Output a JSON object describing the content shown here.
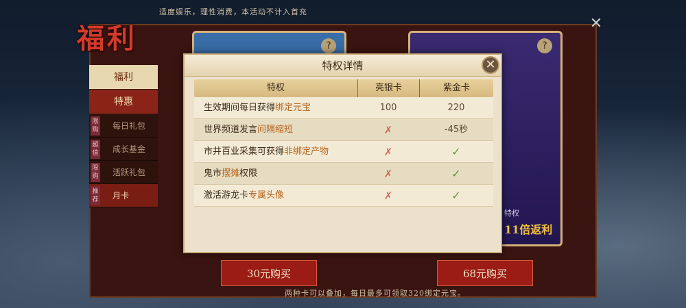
{
  "top_note": "适度娱乐，理性消费，本活动不计入首充",
  "logo_text": "福利",
  "sidebar": {
    "tab_welfare": "福利",
    "tab_special": "特惠",
    "items": [
      {
        "badge": "限购",
        "label": "每日礼包"
      },
      {
        "badge": "超值",
        "label": "成长基金"
      },
      {
        "badge": "限购",
        "label": "活跃礼包"
      },
      {
        "badge": "推荐",
        "label": "月卡"
      }
    ]
  },
  "cards": {
    "right_privilege": "特权",
    "right_rebate": "11倍返利",
    "question": "?"
  },
  "buttons": {
    "buy_left": "30元购买",
    "buy_right": "68元购买"
  },
  "bottom_note": "两种卡可以叠加，每日最多可领取320绑定元宝。",
  "modal": {
    "title": "特权详情",
    "headers": [
      "特权",
      "亮银卡",
      "紫金卡"
    ],
    "rows": [
      {
        "pre": "生效期间每日获得",
        "hl": "绑定元宝",
        "post": "",
        "silver": "100",
        "gold": "220"
      },
      {
        "pre": "世界频道发言",
        "hl": "间隔缩短",
        "post": "",
        "silver": "✗",
        "gold": "-45秒"
      },
      {
        "pre": "市井百业采集可获得",
        "hl": "非绑定产物",
        "post": "",
        "silver": "✗",
        "gold": "✓"
      },
      {
        "pre": "鬼市",
        "hl": "摆摊",
        "post": "权限",
        "silver": "✗",
        "gold": "✓"
      },
      {
        "pre": "激活游龙卡",
        "hl": "专属头像",
        "post": "",
        "silver": "✗",
        "gold": "✓"
      }
    ]
  }
}
